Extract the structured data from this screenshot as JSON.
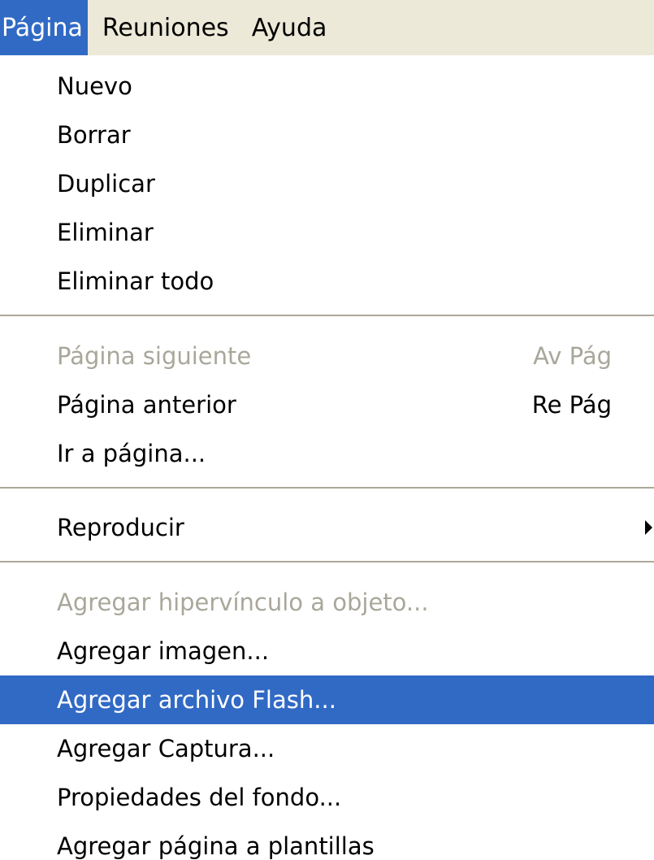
{
  "menubar": {
    "items": [
      {
        "label": "Página"
      },
      {
        "label": "Reuniones"
      },
      {
        "label": "Ayuda"
      }
    ]
  },
  "menu": {
    "group1": [
      "Nuevo",
      "Borrar",
      "Duplicar",
      "Eliminar",
      "Eliminar todo"
    ],
    "group2": [
      {
        "label": "Página siguiente",
        "shortcut": "Av Pág",
        "disabled": true
      },
      {
        "label": "Página anterior",
        "shortcut": "Re Pág"
      },
      {
        "label": "Ir a página..."
      }
    ],
    "group3": [
      {
        "label": "Reproducir",
        "submenu": true
      }
    ],
    "group4": [
      {
        "label": "Agregar hipervínculo a objeto...",
        "disabled": true
      },
      {
        "label": "Agregar imagen..."
      },
      {
        "label": "Agregar archivo Flash...",
        "highlighted": true
      },
      {
        "label": "Agregar Captura..."
      },
      {
        "label": "Propiedades del fondo..."
      },
      {
        "label": "Agregar página a plantillas"
      }
    ]
  },
  "colors": {
    "highlight": "#316ac5",
    "menubar_bg": "#ece9d8",
    "disabled_text": "#a9a79a"
  }
}
